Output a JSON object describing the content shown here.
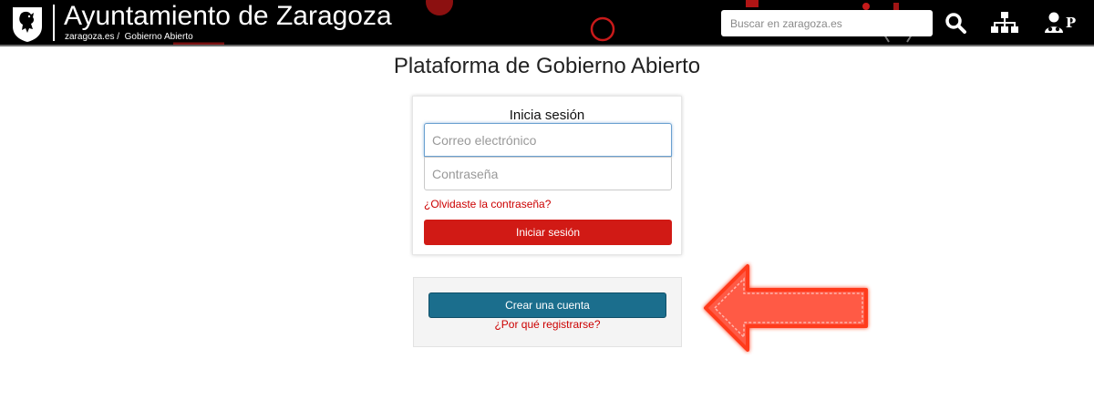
{
  "header": {
    "site_title": "Ayuntamiento de Zaragoza",
    "breadcrumb_home": "zaragoza.es",
    "breadcrumb_sep": "/",
    "breadcrumb_current": "Gobierno Abierto",
    "search_placeholder": "Buscar en zaragoza.es",
    "icons": [
      "search-icon",
      "sitemap-icon",
      "user-p-icon"
    ],
    "user_icon_letter": "P"
  },
  "main": {
    "page_title": "Plataforma de Gobierno Abierto",
    "login": {
      "title": "Inicia sesión",
      "email_placeholder": "Correo electrónico",
      "password_placeholder": "Contraseña",
      "forgot_link": "¿Olvidaste la contraseña?",
      "submit_label": "Iniciar sesión"
    },
    "register": {
      "create_label": "Crear una cuenta",
      "why_link": "¿Por qué registrarse?"
    }
  },
  "colors": {
    "header_bg": "#000000",
    "primary_red": "#d11a15",
    "link_red": "#cc0000",
    "create_blue": "#1b6e8d",
    "arrow_fill": "#ff5a44"
  }
}
